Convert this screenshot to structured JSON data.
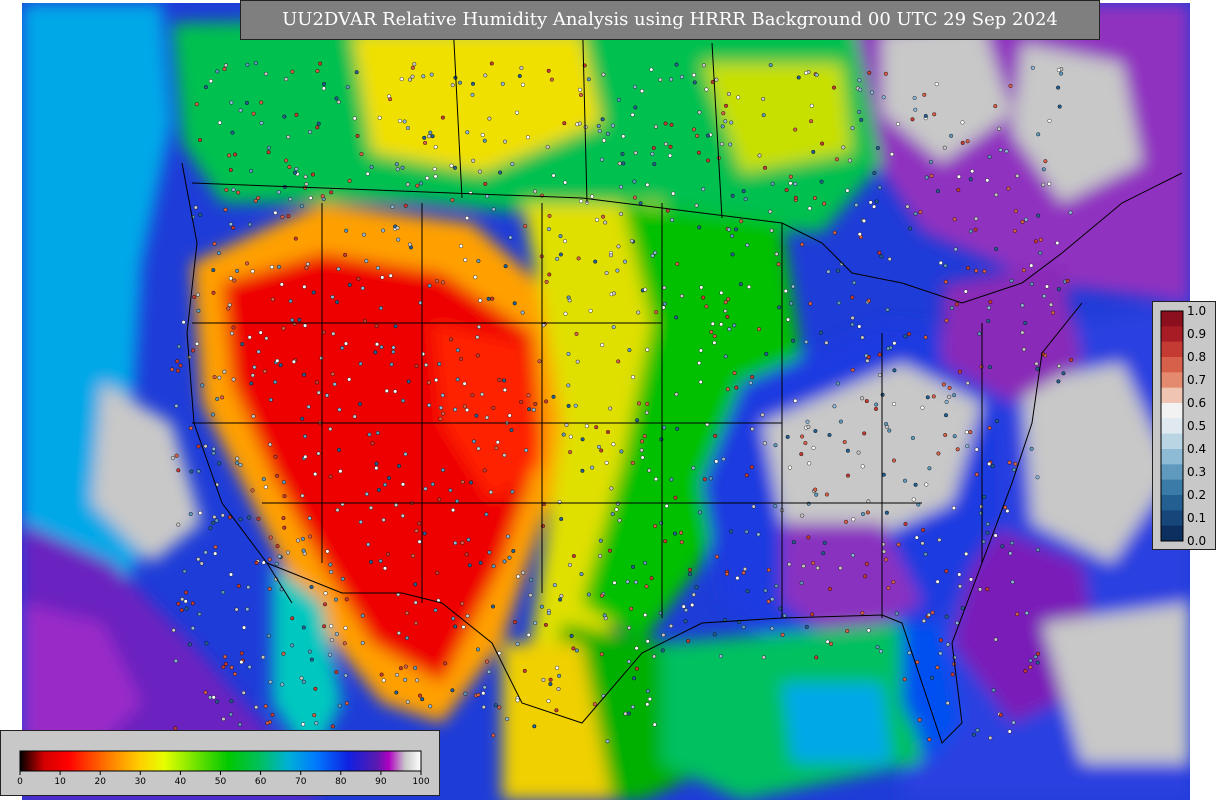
{
  "title": "UU2DVAR Relative Humidity Analysis using HRRR Background 00 UTC 29 Sep 2024",
  "ratio_colorbar": {
    "ticks": [
      "1.0",
      "0.9",
      "0.8",
      "0.7",
      "0.6",
      "0.5",
      "0.4",
      "0.3",
      "0.2",
      "0.1",
      "0.0"
    ],
    "colors": [
      "#8b0f1c",
      "#a81d25",
      "#c43b33",
      "#d7604a",
      "#e48a6e",
      "#f0c4b3",
      "#f2f2f2",
      "#dfe9ef",
      "#b9d4e3",
      "#8dbad4",
      "#5f99bd",
      "#3b7ba8",
      "#245f91",
      "#17467a",
      "#0c2f5f"
    ]
  },
  "rh_colorbar": {
    "ticks": [
      "0",
      "10",
      "20",
      "30",
      "40",
      "50",
      "60",
      "70",
      "80",
      "90",
      "100"
    ],
    "stops": [
      {
        "v": 0,
        "c": "#000000"
      },
      {
        "v": 3,
        "c": "#6b0000"
      },
      {
        "v": 6,
        "c": "#d40000"
      },
      {
        "v": 12,
        "c": "#ff0000"
      },
      {
        "v": 22,
        "c": "#ff7a00"
      },
      {
        "v": 30,
        "c": "#ffd000"
      },
      {
        "v": 36,
        "c": "#e6ff00"
      },
      {
        "v": 45,
        "c": "#5fe000"
      },
      {
        "v": 52,
        "c": "#00c800"
      },
      {
        "v": 60,
        "c": "#00c060"
      },
      {
        "v": 67,
        "c": "#00b0d8"
      },
      {
        "v": 74,
        "c": "#0078ff"
      },
      {
        "v": 82,
        "c": "#1020e0"
      },
      {
        "v": 89,
        "c": "#5a1ab0"
      },
      {
        "v": 92,
        "c": "#b000c0"
      },
      {
        "v": 96,
        "c": "#c8c8c8"
      },
      {
        "v": 100,
        "c": "#ffffff"
      }
    ]
  },
  "map_colors": {
    "ocean": "#1e3cd8",
    "cyan": "#00a8e8",
    "purple": "#7a1ab8",
    "gray": "#c8c8c8",
    "green": "#00c000",
    "yellow": "#f0e000",
    "orange": "#ff8a00",
    "red": "#ee0000",
    "border": "#000000"
  }
}
